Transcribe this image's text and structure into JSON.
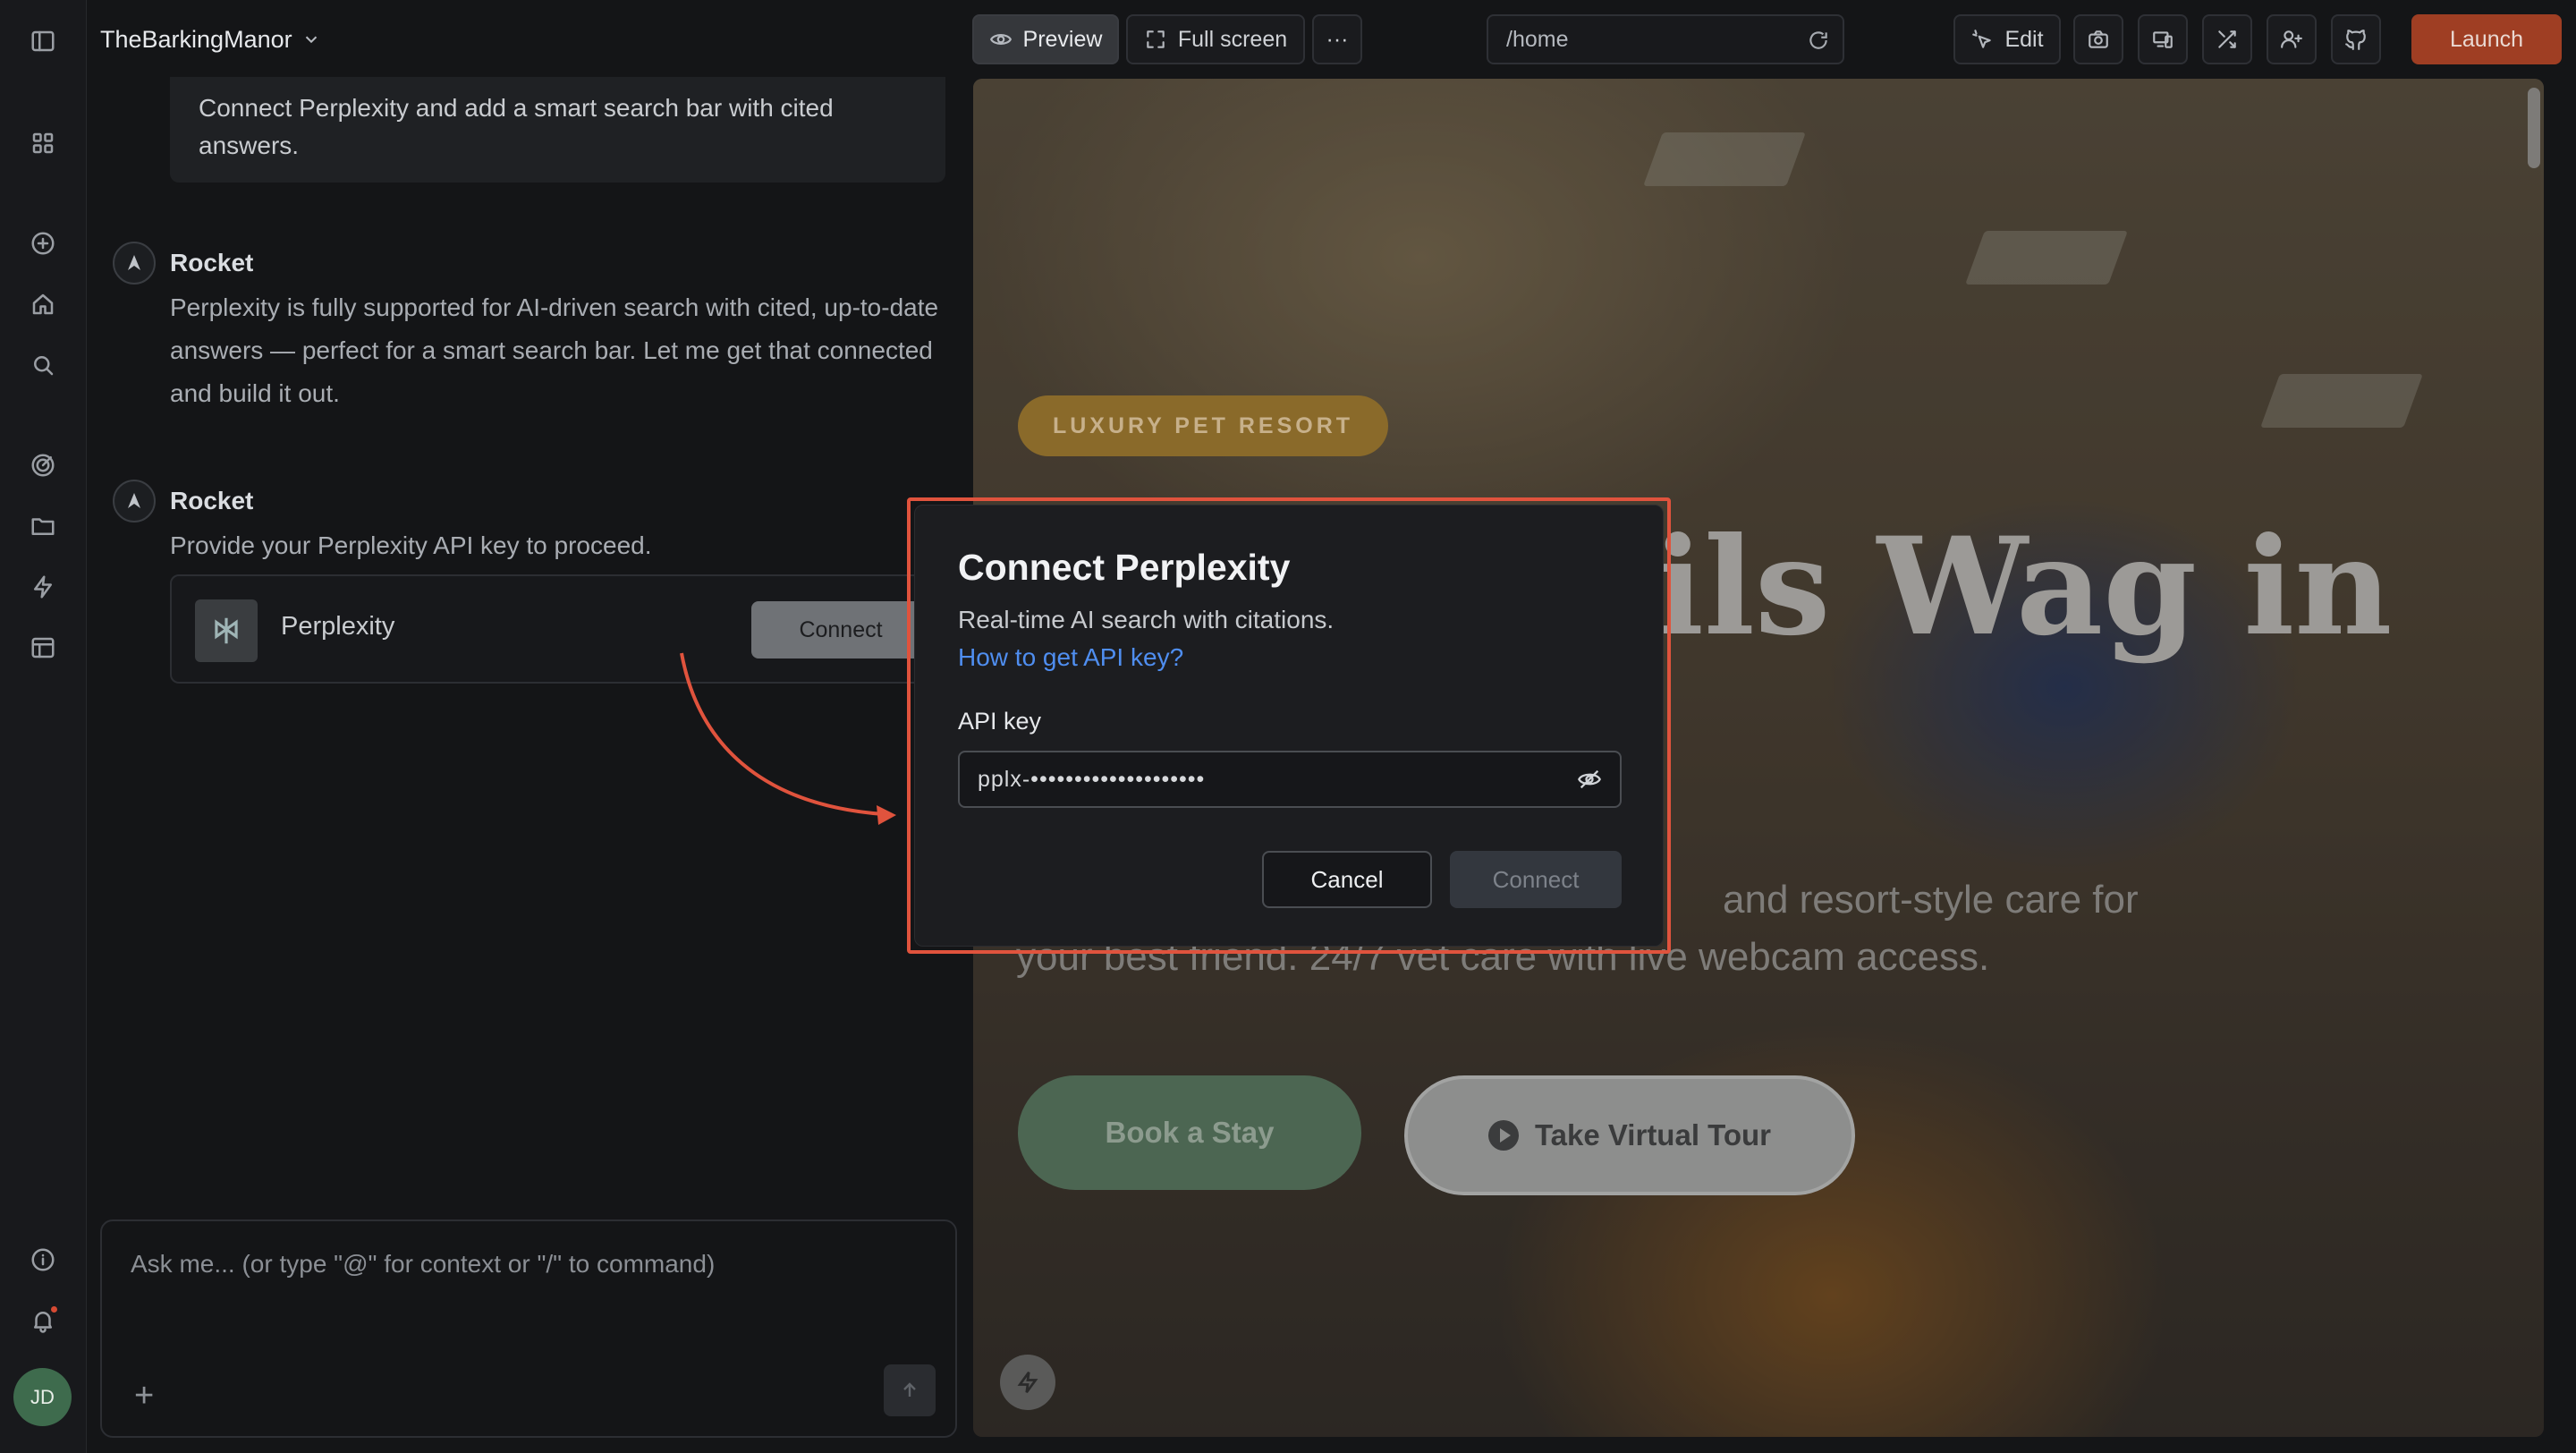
{
  "project": {
    "name": "TheBarkingManor"
  },
  "chat": {
    "user_message": "Connect Perplexity and add a smart search bar with cited answers.",
    "messages": [
      {
        "author": "Rocket",
        "text": "Perplexity is fully supported for AI-driven search with cited, up-to-date answers — perfect for a smart search bar. Let me get that connected and build it out."
      },
      {
        "author": "Rocket",
        "text": "Provide your Perplexity API key to proceed."
      }
    ],
    "integration": {
      "name": "Perplexity",
      "button": "Connect"
    },
    "input_placeholder": "Ask me... (or type \"@\" for context or \"/\" to command)"
  },
  "toolbar": {
    "preview": "Preview",
    "fullscreen": "Full screen",
    "more": "···",
    "url": "/home",
    "edit": "Edit",
    "launch": "Launch"
  },
  "preview": {
    "badge": "LUXURY PET RESORT",
    "headline": "ils Wag in",
    "subtitle_line1": "and resort-style care for",
    "subtitle_line2": "your best friend. 24/7 vet care with live webcam access.",
    "book_button": "Book a Stay",
    "tour_button": "Take Virtual Tour"
  },
  "modal": {
    "title": "Connect Perplexity",
    "description": "Real-time AI search with citations.",
    "link": "How to get API key?",
    "field_label": "API key",
    "field_value": "pplx-••••••••••••••••••••",
    "cancel": "Cancel",
    "connect": "Connect"
  },
  "user": {
    "initials": "JD"
  },
  "colors": {
    "accent_highlight": "#e0533d",
    "launch": "#9f3e23",
    "link": "#4f8ef0",
    "badge": "#8a6a2a"
  },
  "icons": {
    "rail": [
      "sidebar-toggle-icon",
      "grid-icon",
      "plus-circle-icon",
      "home-icon",
      "search-icon",
      "target-icon",
      "folder-icon",
      "bolt-icon",
      "layout-icon",
      "info-icon",
      "bell-icon"
    ]
  }
}
